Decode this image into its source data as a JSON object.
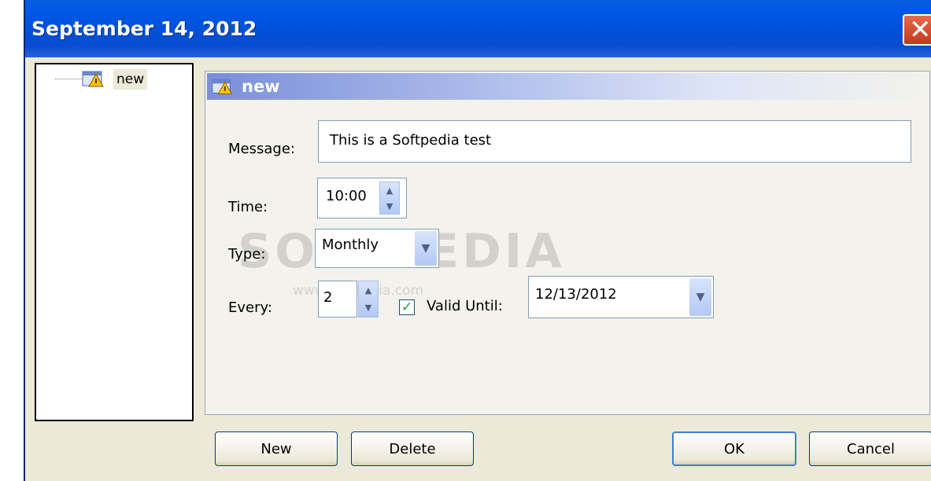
{
  "window": {
    "title": "September 14, 2012"
  },
  "tree": {
    "items": [
      {
        "label": "new"
      }
    ]
  },
  "panel": {
    "title": "new",
    "message": {
      "label": "Message:",
      "value": "This is a Softpedia test"
    },
    "time": {
      "label": "Time:",
      "value": "10:00"
    },
    "type": {
      "label": "Type:",
      "value": "Monthly"
    },
    "every": {
      "label": "Every:",
      "value": "2"
    },
    "valid_until": {
      "label": "Valid Until:",
      "checked": true,
      "value": "12/13/2012"
    }
  },
  "buttons": {
    "new": "New",
    "delete": "Delete",
    "ok": "OK",
    "cancel": "Cancel"
  },
  "watermark": {
    "brand": "SOFTPEDIA",
    "url": "www.softpedia.com"
  },
  "icons": {
    "close": "close-icon",
    "reminder": "reminder-icon",
    "chevron": "chevron-down-icon"
  },
  "colors": {
    "titlebar": "#0054e3",
    "panel_header": "#7a8fd8",
    "button_border": "#003c74"
  }
}
